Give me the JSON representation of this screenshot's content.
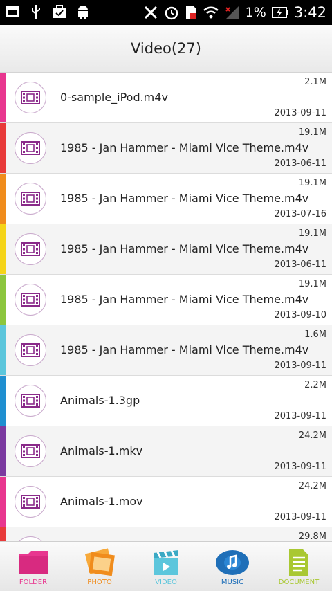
{
  "status_bar": {
    "battery_percent": "1%",
    "time": "3:42"
  },
  "header": {
    "title": "Video(27)"
  },
  "files": [
    {
      "name": "0-sample_iPod.m4v",
      "size": "2.1M",
      "date": "2013-09-11",
      "stripe": "#e8368f"
    },
    {
      "name": "1985 - Jan Hammer - Miami Vice Theme.m4v",
      "size": "19.1M",
      "date": "2013-06-11",
      "stripe": "#e83a3a"
    },
    {
      "name": "1985 - Jan Hammer - Miami Vice Theme.m4v",
      "size": "19.1M",
      "date": "2013-07-16",
      "stripe": "#f08c1c"
    },
    {
      "name": "1985 - Jan Hammer - Miami Vice Theme.m4v",
      "size": "19.1M",
      "date": "2013-06-11",
      "stripe": "#f5d418"
    },
    {
      "name": "1985 - Jan Hammer - Miami Vice Theme.m4v",
      "size": "19.1M",
      "date": "2013-09-10",
      "stripe": "#8cc63e"
    },
    {
      "name": "1985 - Jan Hammer - Miami Vice Theme.m4v",
      "size": "1.6M",
      "date": "2013-09-11",
      "stripe": "#5cc6dc"
    },
    {
      "name": "Animals-1.3gp",
      "size": "2.2M",
      "date": "2013-09-11",
      "stripe": "#1f8fd0"
    },
    {
      "name": "Animals-1.mkv",
      "size": "24.2M",
      "date": "2013-09-11",
      "stripe": "#7b3aa0"
    },
    {
      "name": "Animals-1.mov",
      "size": "24.2M",
      "date": "2013-09-11",
      "stripe": "#e8368f"
    },
    {
      "name": "",
      "size": "29.8M",
      "date": "",
      "stripe": "#e83a3a"
    }
  ],
  "nav": [
    {
      "label": "FOLDER",
      "color": "#e8368f",
      "icon": "folder-icon"
    },
    {
      "label": "PHOTO",
      "color": "#f08c1c",
      "icon": "photo-icon"
    },
    {
      "label": "VIDEO",
      "color": "#5cc6dc",
      "icon": "video-icon"
    },
    {
      "label": "MUSIC",
      "color": "#1f6fb8",
      "icon": "music-icon"
    },
    {
      "label": "DOCUMENT",
      "color": "#a9c832",
      "icon": "document-icon"
    }
  ]
}
